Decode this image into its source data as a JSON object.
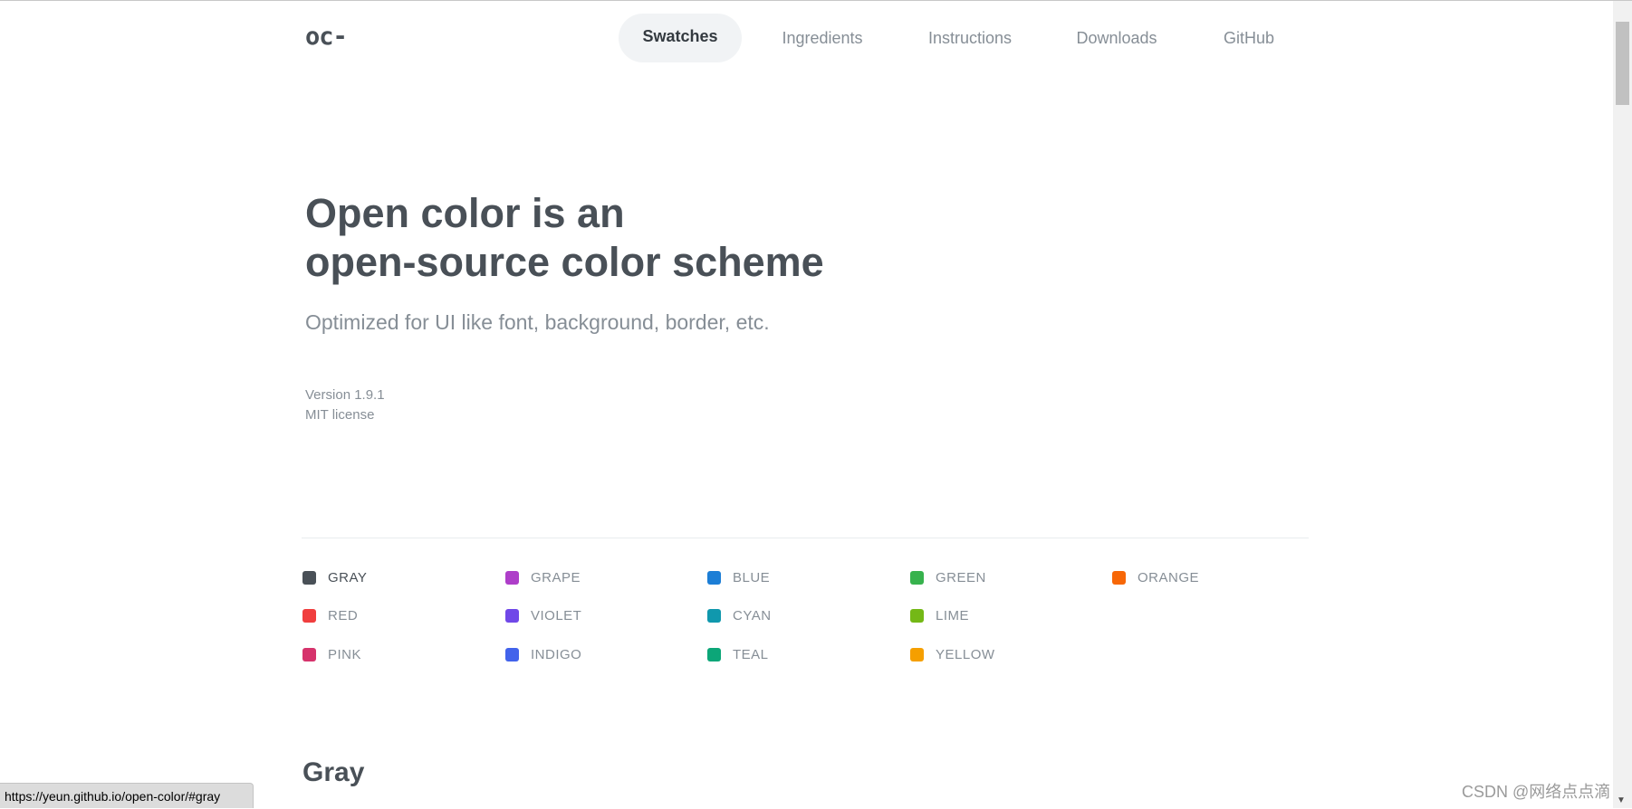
{
  "header": {
    "logo": "oc-",
    "nav": [
      {
        "label": "Swatches",
        "active": true
      },
      {
        "label": "Ingredients"
      },
      {
        "label": "Instructions"
      },
      {
        "label": "Downloads"
      },
      {
        "label": "GitHub"
      }
    ]
  },
  "hero": {
    "title_line1": "Open color is an",
    "title_line2": "open-source color scheme",
    "subtitle": "Optimized for UI like font, background, border, etc.",
    "version": "Version 1.9.1",
    "license": "MIT license"
  },
  "swatches": [
    {
      "label": "GRAY",
      "color": "#495057"
    },
    {
      "label": "RED",
      "color": "#f03e3e"
    },
    {
      "label": "PINK",
      "color": "#d6336c"
    },
    {
      "label": "GRAPE",
      "color": "#ae3ec9"
    },
    {
      "label": "VIOLET",
      "color": "#7048e8"
    },
    {
      "label": "INDIGO",
      "color": "#4263eb"
    },
    {
      "label": "BLUE",
      "color": "#1c7ed6"
    },
    {
      "label": "CYAN",
      "color": "#1098ad"
    },
    {
      "label": "TEAL",
      "color": "#0ca678"
    },
    {
      "label": "GREEN",
      "color": "#37b24d"
    },
    {
      "label": "LIME",
      "color": "#74b816"
    },
    {
      "label": "YELLOW",
      "color": "#f59f00"
    },
    {
      "label": "ORANGE",
      "color": "#f76707"
    }
  ],
  "section_title": "Gray",
  "status_url": "https://yeun.github.io/open-color/#gray",
  "watermark": "CSDN @网络点点滴"
}
